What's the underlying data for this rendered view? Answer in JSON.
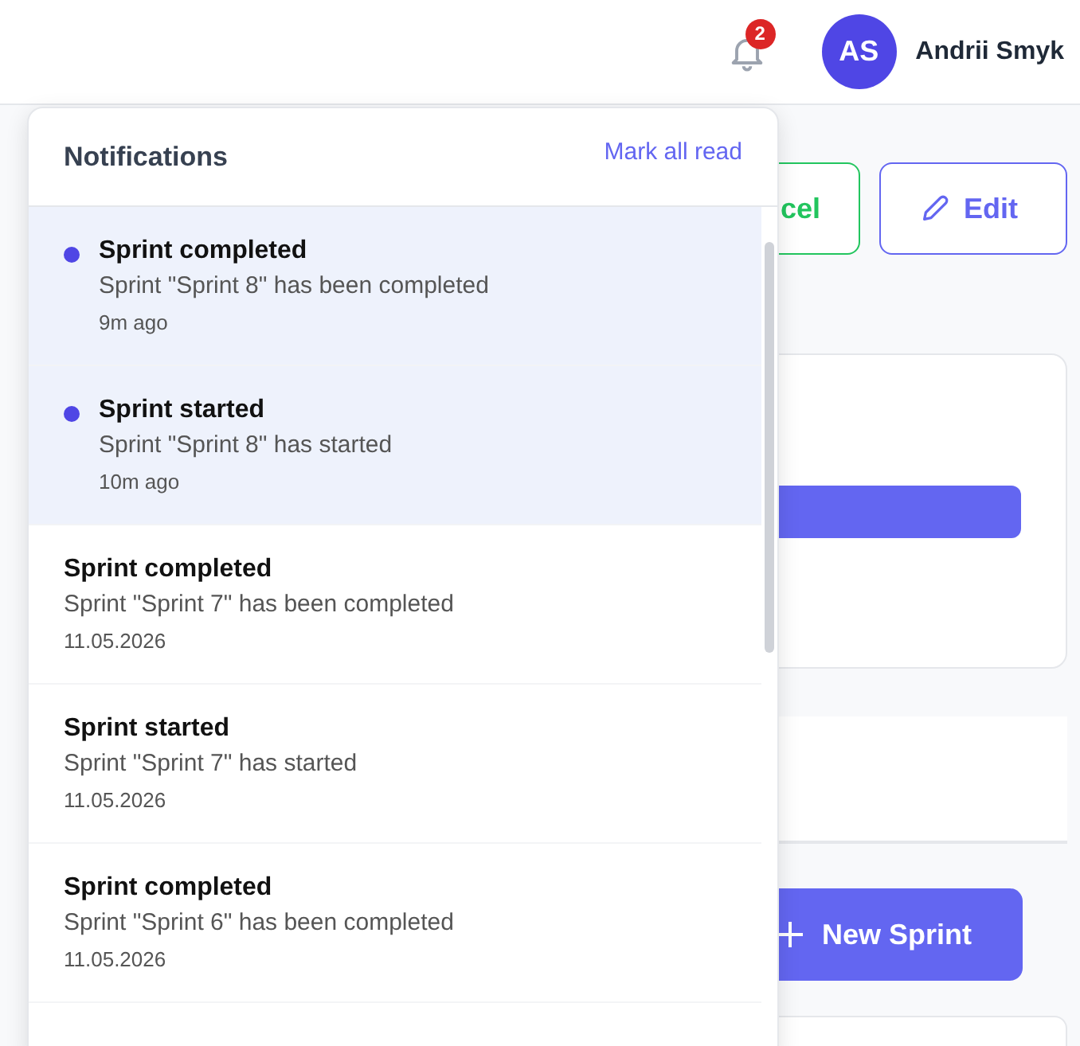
{
  "header": {
    "notification_count": "2",
    "user": {
      "initials": "AS",
      "name": "Andrii Smyk"
    }
  },
  "page": {
    "buttons": [
      {
        "kind": "excel",
        "label": "cel"
      },
      {
        "kind": "edit",
        "label": "Edit"
      }
    ],
    "new_sprint_button": "New Sprint"
  },
  "notifications": {
    "title": "Notifications",
    "mark_all_read": "Mark all read",
    "items": [
      {
        "title": "Sprint completed",
        "message": "Sprint \"Sprint 8\" has been completed",
        "time": "9m ago",
        "unread": true
      },
      {
        "title": "Sprint started",
        "message": "Sprint \"Sprint 8\" has started",
        "time": "10m ago",
        "unread": true
      },
      {
        "title": "Sprint completed",
        "message": "Sprint \"Sprint 7\" has been completed",
        "time": "11.05.2026",
        "unread": false
      },
      {
        "title": "Sprint started",
        "message": "Sprint \"Sprint 7\" has started",
        "time": "11.05.2026",
        "unread": false
      },
      {
        "title": "Sprint completed",
        "message": "Sprint \"Sprint 6\" has been completed",
        "time": "11.05.2026",
        "unread": false
      }
    ]
  }
}
